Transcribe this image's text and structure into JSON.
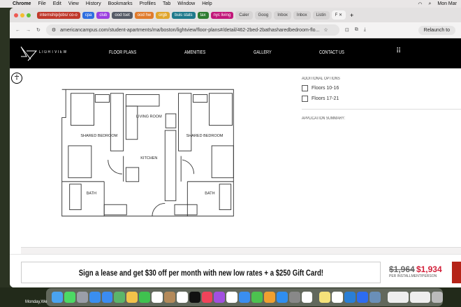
{
  "menubar": {
    "app": "Chrome",
    "items": [
      "File",
      "Edit",
      "View",
      "History",
      "Bookmarks",
      "Profiles",
      "Tab",
      "Window",
      "Help"
    ],
    "clock": "Mon Mar"
  },
  "tabs": {
    "groups": [
      {
        "label": "internship/jobs/ co-o",
        "color": "#c0392b"
      },
      {
        "label": "cpa",
        "color": "#2f6fe0"
      },
      {
        "label": "club",
        "color": "#9b3fe0"
      },
      {
        "label": "ood tset",
        "color": "#555b66"
      },
      {
        "label": "ood hw",
        "color": "#e07b2c"
      },
      {
        "label": "orgb",
        "color": "#e0a52c"
      },
      {
        "label": "buis stats",
        "color": "#1f7a8c"
      },
      {
        "label": "tax",
        "color": "#2e7d32"
      },
      {
        "label": "nyc living",
        "color": "#c2187a"
      }
    ],
    "pages": [
      "Caler",
      "Goog",
      "Inbox",
      "Inbox",
      "Listin",
      "F"
    ]
  },
  "address": {
    "url": "americancampus.com/student-apartments/ma/boston/lightview/floor-plans#/detail/462-2bed-2bathasharedbedroom-flo...",
    "relaunch": "Relaunch to"
  },
  "nav": {
    "logo": "LIGHTVIEW",
    "items": [
      "FLOOR PLANS",
      "AMENITIES",
      "GALLERY",
      "CONTACT US"
    ]
  },
  "floorplan": {
    "rooms": [
      "LIVING ROOM",
      "SHARED BEDROOM",
      "SHARED BEDROOM",
      "KITCHEN",
      "BATH",
      "BATH"
    ]
  },
  "options": {
    "heading": "ADDITIONAL OPTIONS",
    "items": [
      {
        "label": "Floors 10-16",
        "checked": false
      },
      {
        "label": "Floors 17-21",
        "checked": false
      }
    ],
    "summary": "APPLICATION SUMMARY:"
  },
  "promo": {
    "text": "Sign a lease and get $30 off per month with new low rates + a $250 Gift Card!",
    "old_price": "$1,964",
    "new_price": "$1,934",
    "per": "PER INSTALLMENT/PERSON",
    "accent": "#d3203a"
  },
  "desktop": {
    "label": "Monday,We"
  }
}
